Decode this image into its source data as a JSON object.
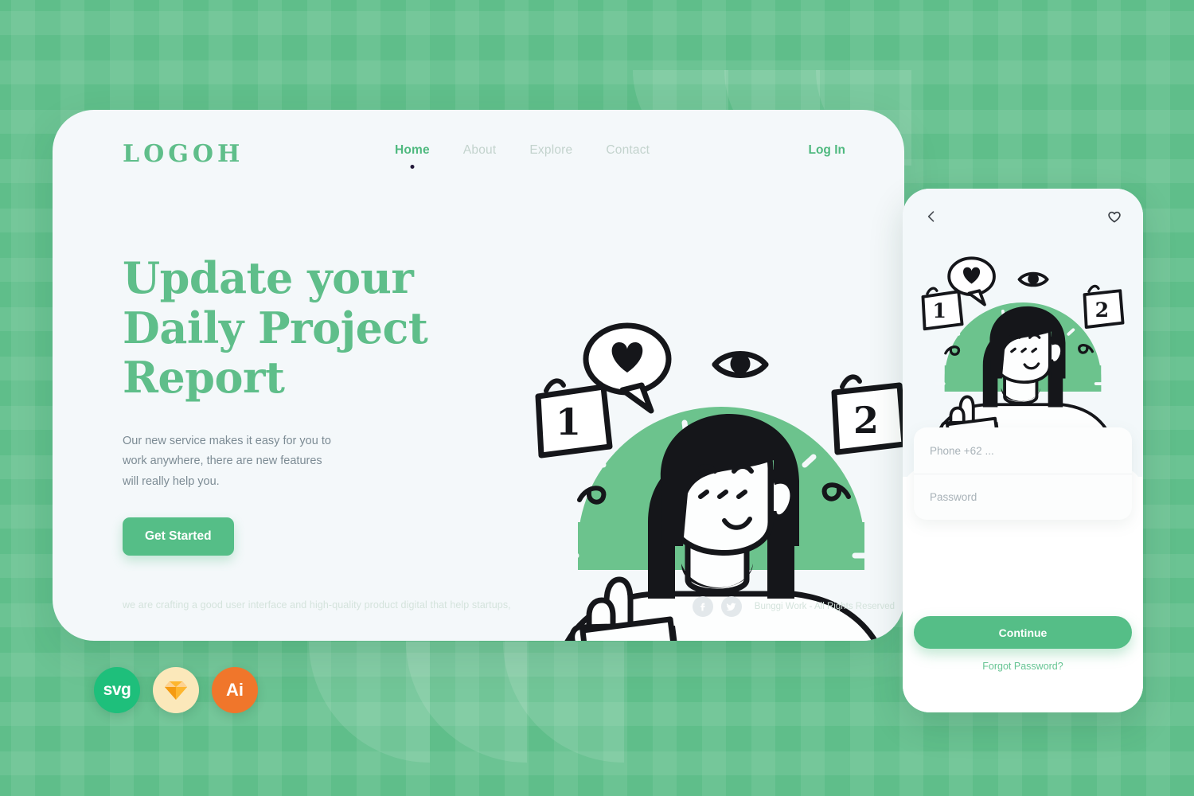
{
  "theme": {
    "brand_green": "#5FBE8A",
    "button_green": "#55BE87",
    "card_bg": "#F4F8FA",
    "muted_text": "#7C8B94",
    "nav_inactive": "#C3D3CD",
    "ink": "#241A3A"
  },
  "header": {
    "logo": "LOGOH",
    "nav": [
      {
        "label": "Home",
        "active": true
      },
      {
        "label": "About",
        "active": false
      },
      {
        "label": "Explore",
        "active": false
      },
      {
        "label": "Contact",
        "active": false
      }
    ],
    "login_label": "Log In"
  },
  "hero": {
    "headline_line1": "Update your",
    "headline_line2": "Daily Project",
    "headline_line3": "Report",
    "subcopy": "Our new service makes it easy for you to work anywhere, there are new features will really help you.",
    "cta_label": "Get Started"
  },
  "illustration": {
    "calendar_left_number": "1",
    "calendar_right_number": "2",
    "bubble_icon": "heart-icon",
    "eye_icon": "eye-doodle-icon"
  },
  "footer": {
    "tagline": "we are crafting a good user interface and high-quality product digital that help startups,",
    "copyright": "Bunggi Work - All Rights Reserved",
    "social": [
      {
        "name": "facebook-icon"
      },
      {
        "name": "twitter-icon"
      }
    ]
  },
  "phone": {
    "back_icon": "chevron-left-icon",
    "favorite_icon": "heart-outline-icon",
    "phone_placeholder": "Phone +62 ...",
    "password_placeholder": "Password",
    "continue_label": "Continue",
    "forgot_label": "Forgot Password?"
  },
  "badges": [
    {
      "label": "svg",
      "name": "svg-format-badge"
    },
    {
      "label": "",
      "name": "sketch-format-badge"
    },
    {
      "label": "Ai",
      "name": "illustrator-format-badge"
    }
  ]
}
